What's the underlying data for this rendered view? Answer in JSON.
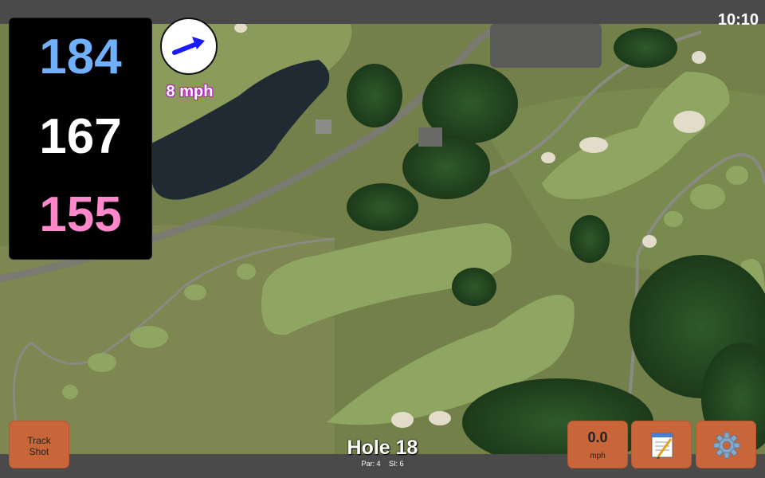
{
  "status": {
    "time": "10:10"
  },
  "distances": {
    "back": "184",
    "center": "167",
    "front": "155"
  },
  "wind": {
    "speed": "8 mph",
    "arrow_icon": "arrow-right-icon",
    "arrow_color": "#1a1aff"
  },
  "hole": {
    "title": "Hole 18",
    "par": "Par: 4",
    "stroke_index": "SI: 6"
  },
  "buttons": {
    "track_shot": "Track\nShot",
    "speed_value": "0.0",
    "speed_unit": "mph",
    "notes_icon": "notepad-icon",
    "settings_icon": "gear-icon"
  },
  "colors": {
    "back": "#6fb0ff",
    "center": "#ffffff",
    "front": "#ff88cc",
    "button": "#c8663a"
  }
}
